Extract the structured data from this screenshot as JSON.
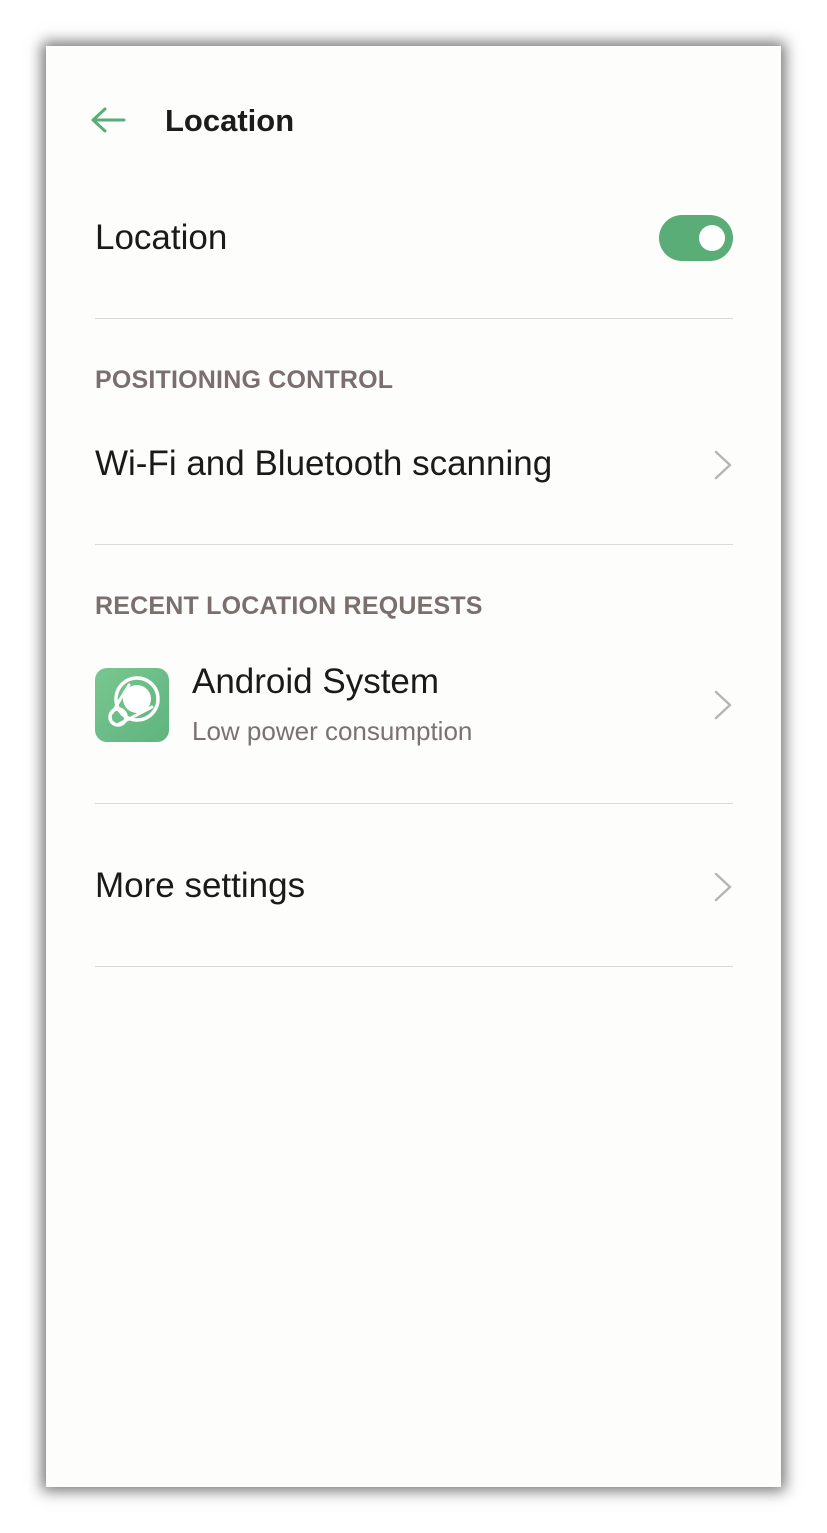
{
  "header": {
    "back_icon": "arrow-left-icon",
    "title": "Location"
  },
  "location_toggle": {
    "label": "Location",
    "state": "on",
    "accent_color": "#5aad77"
  },
  "positioning_control": {
    "section_label": "POSITIONING CONTROL",
    "items": [
      {
        "label": "Wi-Fi and Bluetooth scanning",
        "icon": "chevron-right-icon"
      }
    ]
  },
  "recent_requests": {
    "section_label": "RECENT LOCATION REQUESTS",
    "items": [
      {
        "app_name": "Android System",
        "subtitle": "Low power consumption",
        "icon": "android-system-app-icon"
      }
    ]
  },
  "more_settings": {
    "label": "More settings",
    "icon": "chevron-right-icon"
  }
}
